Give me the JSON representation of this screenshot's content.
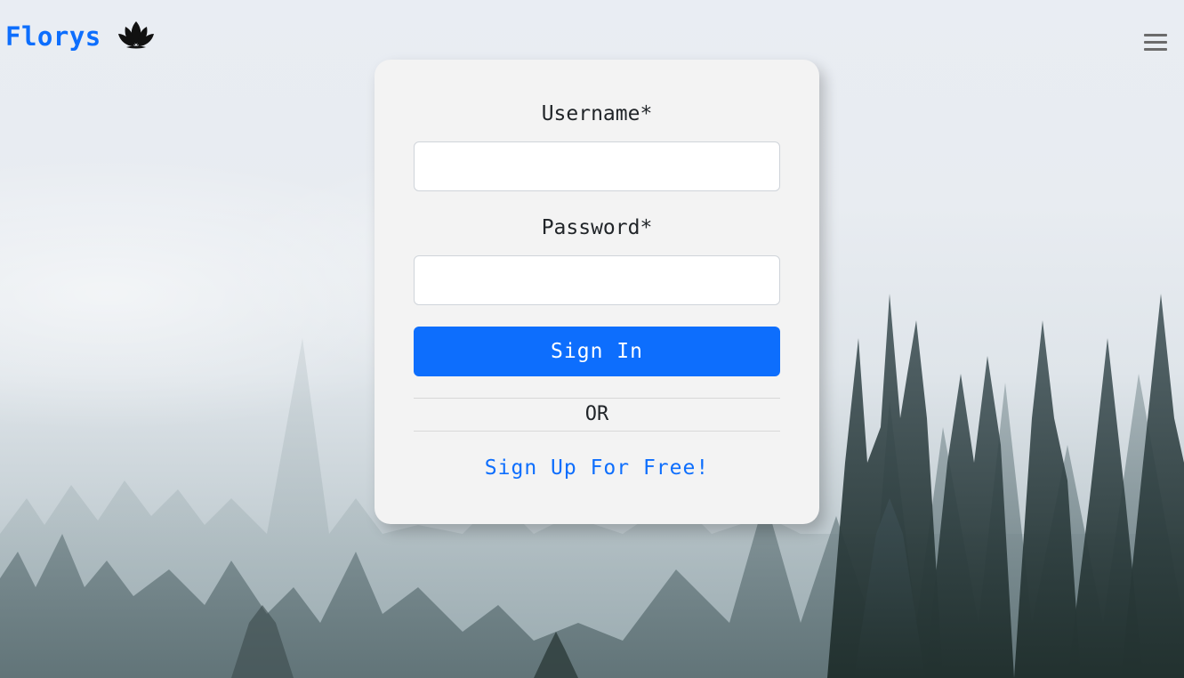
{
  "navbar": {
    "brand_name": "Florys",
    "logo_icon": "lotus-flower-icon",
    "menu_icon": "hamburger-menu-icon"
  },
  "login_form": {
    "username_label": "Username*",
    "username_value": "",
    "password_label": "Password*",
    "password_value": "",
    "sign_in_label": "Sign In",
    "or_label": "OR",
    "sign_up_label": "Sign Up For Free!"
  },
  "background": {
    "image": "foggy-forest"
  },
  "colors": {
    "accent": "#0d6efd",
    "card_background": "#f3f3f3",
    "text": "#212529",
    "menu_icon": "#6b6b6b"
  }
}
